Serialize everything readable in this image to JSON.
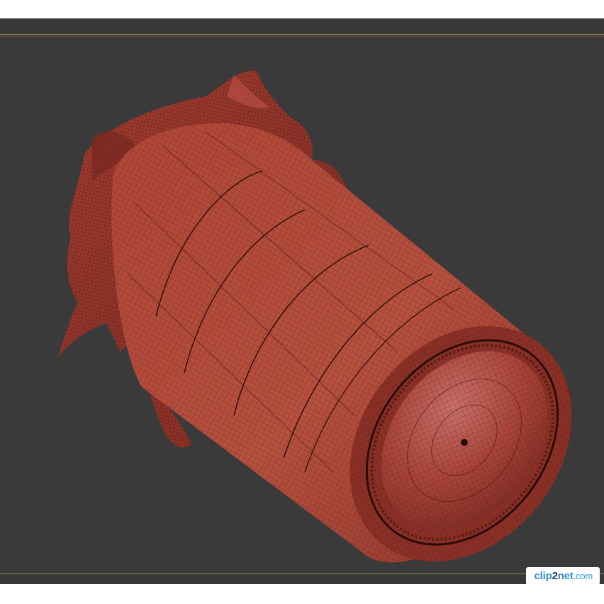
{
  "viewport": {
    "background": "#3a3a3a",
    "frame_line_color": "#9c845a",
    "object_color": "#b04a3c",
    "wire_color": "#2a0c08",
    "object": "jar-with-cloth-cover-wireframe"
  },
  "watermark": {
    "part_a": "clip",
    "part_b": "2",
    "part_c": "net",
    "part_d": ".com"
  }
}
